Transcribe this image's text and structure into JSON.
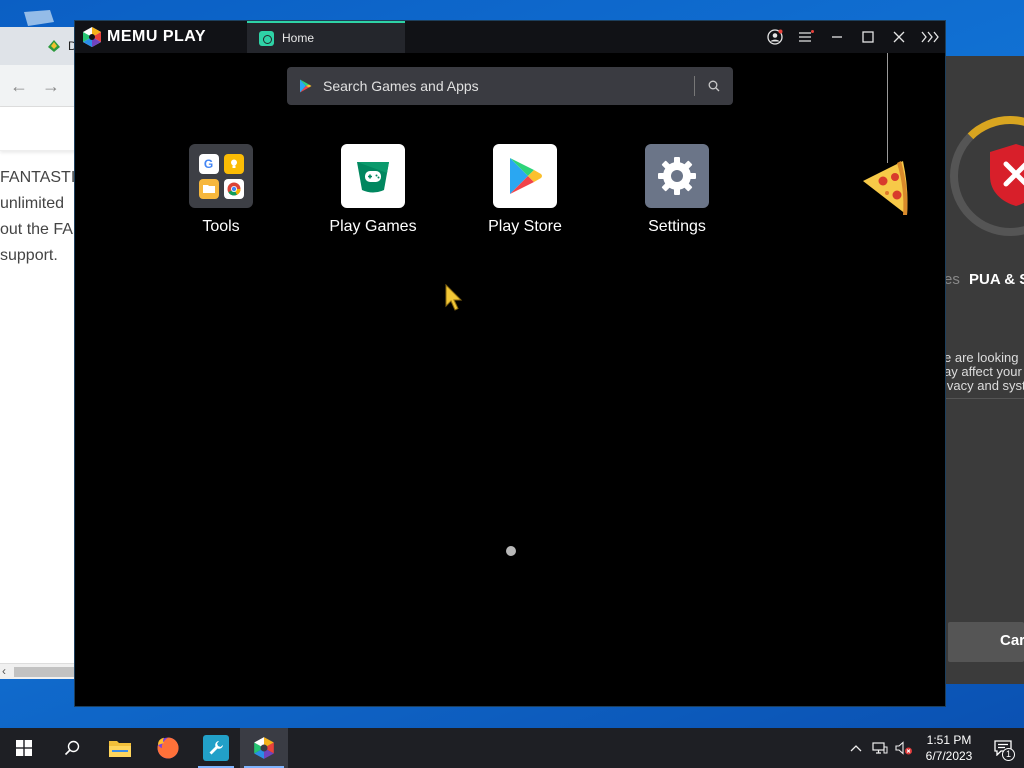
{
  "background_browser": {
    "tab_label": "D",
    "lines": [
      "FANTASTIC",
      "unlimited",
      "out the FA",
      "support."
    ]
  },
  "background_security": {
    "label_dim": "es",
    "label_strong": "PUA & S",
    "desc_lines": [
      "e are looking",
      "ay affect your",
      "ivacy and syst"
    ],
    "cancel_label": "Car"
  },
  "memu": {
    "brand": "MEMU PLAY",
    "tab_home": "Home",
    "search_placeholder": "Search Games and Apps",
    "apps": [
      {
        "label": "Tools",
        "icon": "tools-folder-icon"
      },
      {
        "label": "Play Games",
        "icon": "play-games-icon"
      },
      {
        "label": "Play Store",
        "icon": "play-store-icon"
      },
      {
        "label": "Settings",
        "icon": "settings-gear-icon"
      }
    ],
    "accent": "#2ed3a6"
  },
  "taskbar": {
    "time": "1:51 PM",
    "date": "6/7/2023",
    "notification_count": "1"
  }
}
